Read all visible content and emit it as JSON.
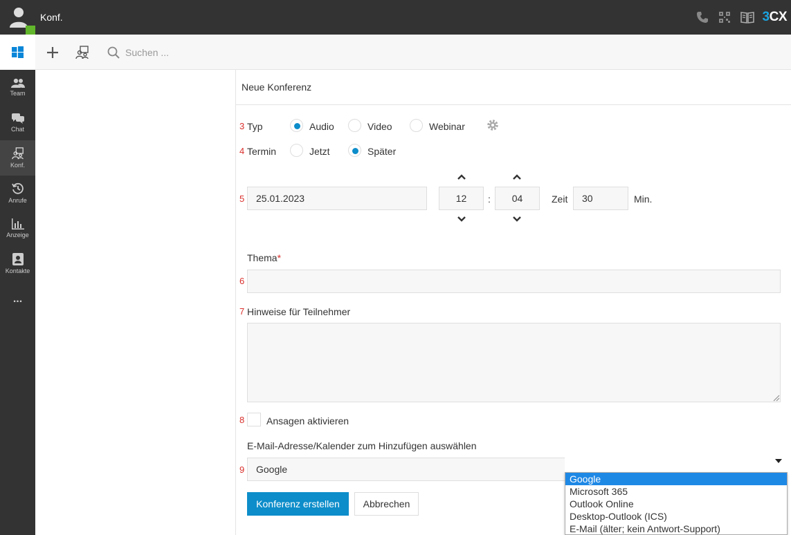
{
  "header": {
    "title": "Konf.",
    "logo_prefix": "3",
    "logo_suffix": "CX"
  },
  "toolbar": {
    "search_placeholder": "Suchen ..."
  },
  "sidebar": {
    "items": [
      {
        "label": "Team",
        "icon": "team-icon"
      },
      {
        "label": "Chat",
        "icon": "chat-icon"
      },
      {
        "label": "Konf.",
        "icon": "conference-icon",
        "active": true
      },
      {
        "label": "Anrufe",
        "icon": "history-icon"
      },
      {
        "label": "Anzeige",
        "icon": "chart-icon"
      },
      {
        "label": "Kontakte",
        "icon": "contacts-icon"
      },
      {
        "label": "...",
        "icon": "more-icon"
      }
    ]
  },
  "form": {
    "heading": "Neue Konferenz",
    "numbers": [
      "3",
      "4",
      "5",
      "6",
      "7",
      "8",
      "9"
    ],
    "type_label": "Typ",
    "type_options": [
      "Audio",
      "Video",
      "Webinar"
    ],
    "type_selected": "Audio",
    "when_label": "Termin",
    "when_options": [
      "Jetzt",
      "Später"
    ],
    "when_selected": "Später",
    "date": "25.01.2023",
    "hour": "12",
    "time_sep": ":",
    "minute": "04",
    "duration_label": "Zeit",
    "duration": "30",
    "duration_unit": "Min.",
    "subject_label": "Thema",
    "required_mark": "*",
    "subject_value": "",
    "notes_label": "Hinweise für Teilnehmer",
    "notes_value": "",
    "prompts_label": "Ansagen aktivieren",
    "calendar_label": "E-Mail-Adresse/Kalender zum Hinzufügen auswählen",
    "calendar_value": "Google",
    "calendar_options": [
      "Google",
      "Microsoft 365",
      "Outlook Online",
      "Desktop-Outlook (ICS)",
      "E-Mail (älter; kein Antwort-Support)"
    ],
    "create_button": "Konferenz erstellen",
    "cancel_button": "Abbrechen"
  },
  "colors": {
    "accent": "#0d8dca",
    "topbar": "#333333",
    "status_green": "#62b62b",
    "number_red": "#d9302c"
  }
}
